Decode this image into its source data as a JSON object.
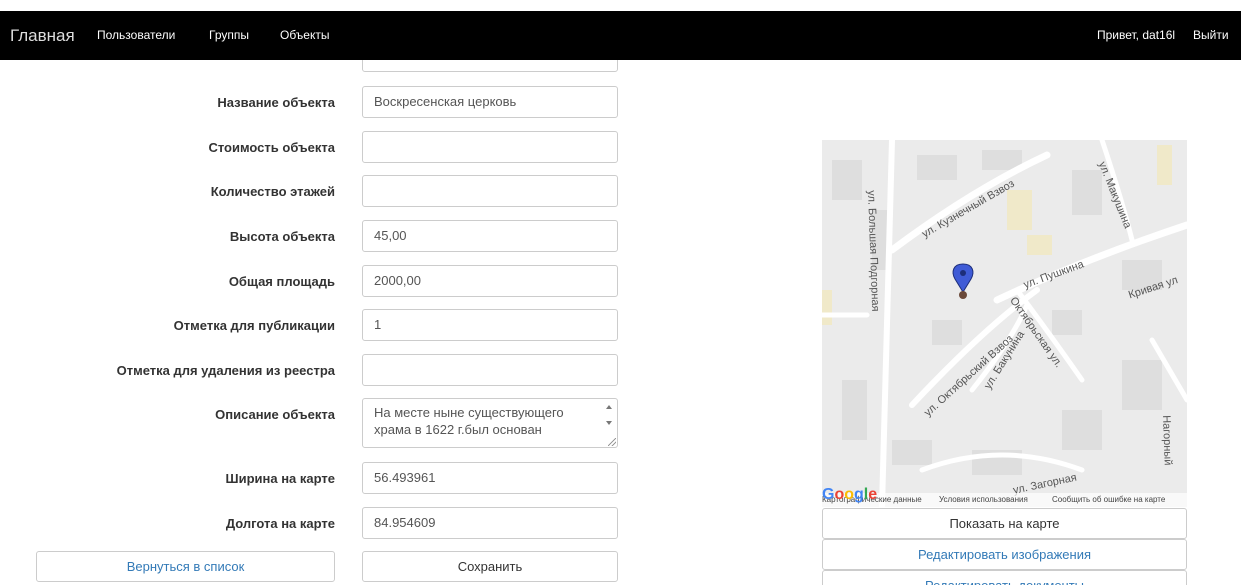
{
  "navbar": {
    "brand": "Главная",
    "items": [
      "Пользователи",
      "Группы",
      "Объекты"
    ],
    "greeting": "Привет, dat16l",
    "logout": "Выйти"
  },
  "form": {
    "fields": [
      {
        "label": "Название объекта",
        "value": "Воскресенская церковь"
      },
      {
        "label": "Стоимость объекта",
        "value": ""
      },
      {
        "label": "Количество этажей",
        "value": ""
      },
      {
        "label": "Высота объекта",
        "value": "45,00"
      },
      {
        "label": "Общая площадь",
        "value": "2000,00"
      },
      {
        "label": "Отметка для публикации",
        "value": "1"
      },
      {
        "label": "Отметка для удаления из реестра",
        "value": ""
      }
    ],
    "description": {
      "label": "Описание объекта",
      "value": "На месте ныне существующего храма в 1622 г.был основан"
    },
    "lat": {
      "label": "Ширина на карте",
      "value": "56.493961"
    },
    "lng": {
      "label": "Долгота на карте",
      "value": "84.954609"
    },
    "back_button": "Вернуться в список",
    "save_button": "Сохранить"
  },
  "map": {
    "streets": {
      "kuznechny": "ул. Кузнечный Взвоз",
      "makushina": "ул. Макушина",
      "bolshaya": "ул. Большая Подгорная",
      "pushkina": "ул. Пушкина",
      "krivaya": "Кривая ул",
      "oktyabrsky": "ул. Октябрьский Взвоз",
      "bakunina": "ул. Бакунина",
      "oktyabrskaya": "Октябрьская ул.",
      "zagornaya": "ул. Загорная",
      "nagorny": "Нагорный"
    },
    "footer_data": "Картографические данные",
    "footer_terms": "Условия использования",
    "footer_report": "Сообщить об ошибке на карте",
    "google": "Google"
  },
  "side_buttons": {
    "show_on_map": "Показать на карте",
    "edit_images": "Редактировать изображения",
    "edit_documents": "Редактировать документы"
  }
}
